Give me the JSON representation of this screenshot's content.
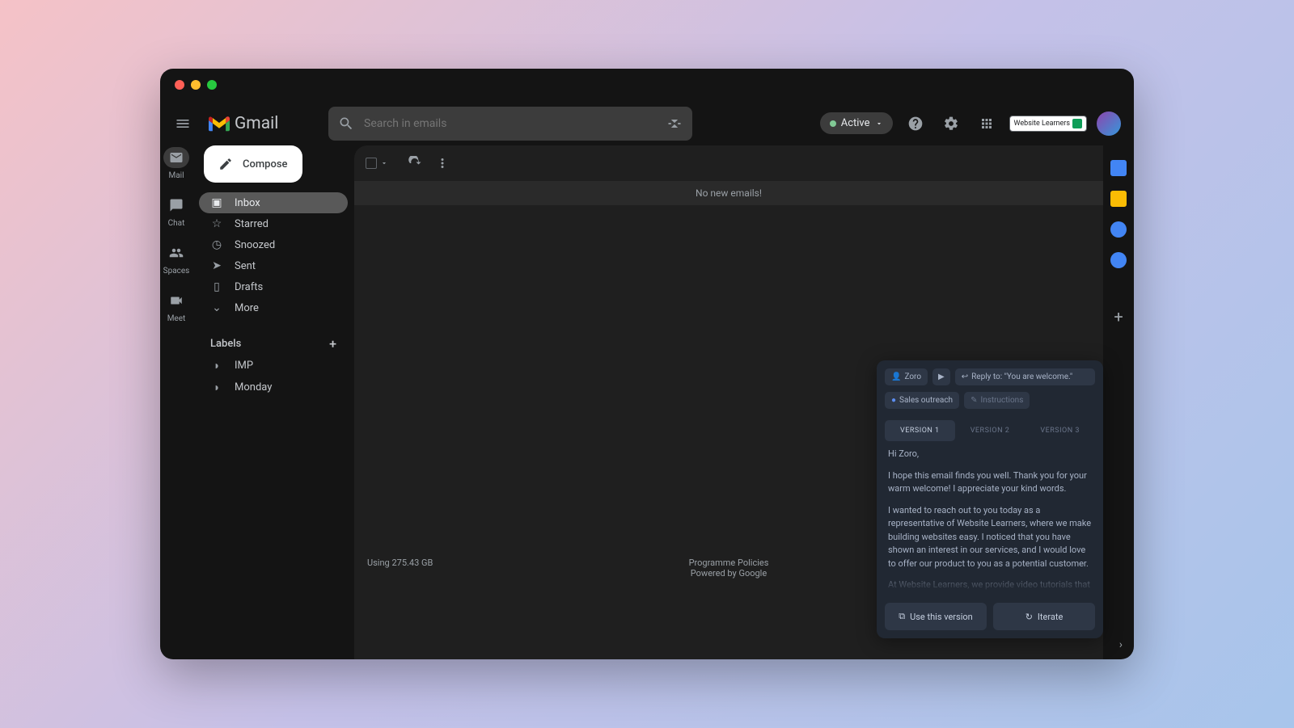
{
  "app": {
    "name": "Gmail"
  },
  "search": {
    "placeholder": "Search in emails"
  },
  "status": {
    "label": "Active"
  },
  "account": {
    "badge": "Website Learners"
  },
  "rail": [
    {
      "label": "Mail",
      "active": true
    },
    {
      "label": "Chat",
      "active": false
    },
    {
      "label": "Spaces",
      "active": false
    },
    {
      "label": "Meet",
      "active": false
    }
  ],
  "compose": {
    "label": "Compose"
  },
  "nav": {
    "items": [
      {
        "label": "Inbox",
        "active": true
      },
      {
        "label": "Starred",
        "active": false
      },
      {
        "label": "Snoozed",
        "active": false
      },
      {
        "label": "Sent",
        "active": false
      },
      {
        "label": "Drafts",
        "active": false
      },
      {
        "label": "More",
        "active": false
      }
    ],
    "labels_header": "Labels",
    "labels": [
      {
        "label": "IMP"
      },
      {
        "label": "Monday"
      }
    ]
  },
  "main": {
    "empty": "No new emails!",
    "footer": {
      "storage": "Using 275.43 GB",
      "policies": "Programme Policies",
      "powered": "Powered by Google"
    }
  },
  "ai_panel": {
    "chips": {
      "recipient": "Zoro",
      "reply": "Reply to: \"You are welcome.\"",
      "topic": "Sales outreach",
      "instructions": "Instructions"
    },
    "tabs": [
      "VERSION 1",
      "VERSION 2",
      "VERSION 3"
    ],
    "active_tab": 0,
    "body": {
      "greeting": "Hi Zoro,",
      "p1": "I hope this email finds you well. Thank you for your warm welcome! I appreciate your kind words.",
      "p2": "I wanted to reach out to you today as a representative of Website Learners, where we make building websites easy. I noticed that you have shown an interest in our services, and I would love to offer our product to you as a potential customer.",
      "p3": "At Website Learners, we provide video tutorials that guide individuals through the process of creating their own website. Our step-by-step instructions are designed to be beginner-friendly and accessible to everyone. Whether you're starting an online store, a blog, or a portfolio website, we have resources available to help you achieve your goals."
    },
    "actions": {
      "use": "Use this version",
      "iterate": "Iterate"
    }
  }
}
